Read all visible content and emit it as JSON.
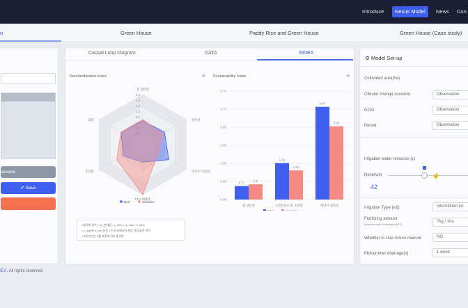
{
  "nav": {
    "items": [
      "Introduce",
      "Nexus Model",
      "News",
      "Con"
    ],
    "active": "Nexus Model"
  },
  "subnav": {
    "first_fragment": "o",
    "tabs": [
      "Green House",
      "Paddy Rice and Green House",
      "Green House (Case study)"
    ]
  },
  "left_panel": {
    "scenario_button": "cenario",
    "save_button": "Save"
  },
  "center_tabs": [
    "Causal Loop Diagram",
    "DATA",
    "INDEX"
  ],
  "active_center_tab": "INDEX",
  "radar": {
    "title": "Standardization Index",
    "axis_labels": [
      "종 생산량",
      "생산성",
      "에너지 이용량",
      "CO2 배출량",
      "토지량",
      "휴량"
    ],
    "tick_labels": [
      "2.0",
      "1.8",
      "1.6",
      "1.4",
      "1.2",
      "1.0",
      "0.8",
      "0.6"
    ],
    "legend": [
      "BAU",
      "Scenario"
    ],
    "notes": [
      "표준화 지수 = (x_현재값 - x_min) / (x_max - x_min)",
      "x_max와 x_min 모든 시나리오에서의 최대, 최소값의 의미",
      "표준지수는 0을 표준에 따라 평가한"
    ]
  },
  "chart_data": [
    {
      "type": "radar",
      "title": "Standardization Index",
      "axes": [
        "종 생산량",
        "생산성",
        "에너지 이용량",
        "CO2 배출량",
        "토지량",
        "휴량"
      ],
      "rlim": [
        0,
        2.0
      ],
      "series": [
        {
          "name": "BAU",
          "values": [
            0.95,
            1.0,
            1.2,
            0.7,
            0.9,
            1.0
          ]
        },
        {
          "name": "Scenario",
          "values": [
            1.0,
            0.9,
            0.7,
            2.0,
            1.2,
            1.0
          ]
        }
      ]
    },
    {
      "type": "bar",
      "title": "Sustainability Index",
      "categories": [
        "물 생산성",
        "1인당 탄소 물 소비량",
        "에너지 생산성"
      ],
      "series": [
        {
          "name": "BAU",
          "values": [
            0.71,
            1.92,
            4.87
          ]
        },
        {
          "name": "Scenario",
          "values": [
            0.8,
            1.53,
            3.85
          ]
        }
      ],
      "yticks": [
        "0.00",
        "0.95",
        "1.90",
        "2.85",
        "3.80",
        "4.75",
        "5.70"
      ],
      "ylim": [
        0,
        5.7
      ]
    }
  ],
  "bars": {
    "title": "Sustainability Index",
    "value_labels": [
      "0.71",
      "0.8",
      "1.92",
      "1.53",
      "4.87",
      "3.85"
    ]
  },
  "model": {
    "title": "Model Set-up",
    "cultivated_area_label": "Cultivated area(ha)",
    "climate_label": "Climate change scenario",
    "climate_value": "Observation",
    "gcm_label": "GCM",
    "gcm_value": "Observation",
    "period_label": "Period",
    "period_value": "Observation",
    "irrigation_resource_label": "Irrigation water resource (ε)",
    "reservoir_label": "Reservoir",
    "reservoir_value": "42",
    "irrigation_type_label": "Irrigation Type (ε/ξ)",
    "irrigation_type_value": "Intermittent irri",
    "fertilizing_label": "Fertilizing amount",
    "fertilizing_sub": "(total amount of nitrogen)(N/T)",
    "fertilizing_value": "7kg / 10a",
    "green_manure_label": "Whether to Use Green manure",
    "green_manure_value": "NO",
    "midsummer_label": "Midsummer drainage(s)",
    "midsummer_value": "1 week"
  },
  "footer": {
    "link": "IEA",
    "text": ". All rights reserved."
  },
  "colors": {
    "topbar": "#1c1f33",
    "accent": "#3d5ef0",
    "bau": "#3f5ff0",
    "scenario": "#f58b84",
    "orange": "#f5704f"
  }
}
